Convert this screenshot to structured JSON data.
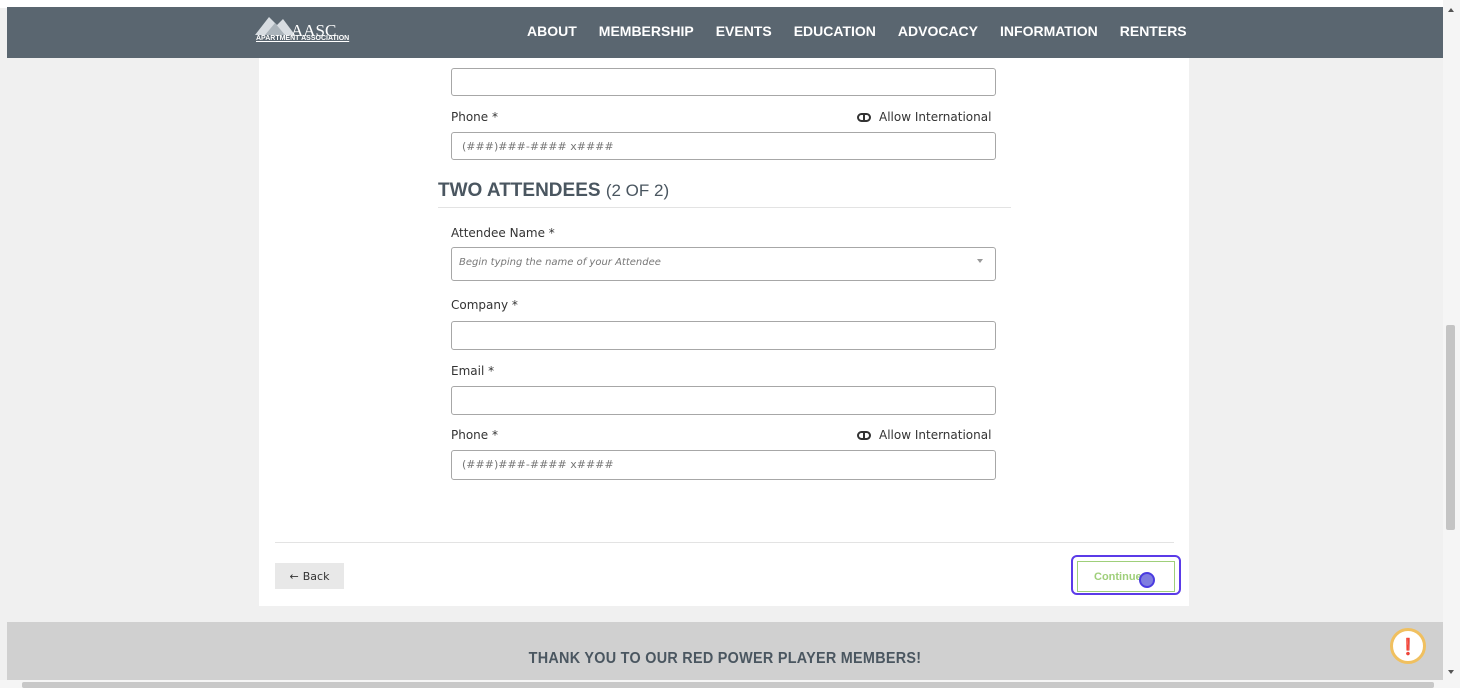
{
  "header": {
    "logo_text": "AASC",
    "logo_sub": "APARTMENT ASSOCIATION",
    "nav": [
      "ABOUT",
      "MEMBERSHIP",
      "EVENTS",
      "EDUCATION",
      "ADVOCACY",
      "INFORMATION",
      "RENTERS"
    ]
  },
  "form": {
    "attendee1": {
      "phone_label": "Phone *",
      "phone_placeholder": "(###)###-#### x####",
      "allow_international": "Allow International"
    },
    "section": {
      "title": "TWO ATTENDEES",
      "count": "(2 OF 2)"
    },
    "attendee2": {
      "name_label": "Attendee Name *",
      "name_placeholder": "Begin typing the name of your Attendee",
      "company_label": "Company *",
      "email_label": "Email *",
      "phone_label": "Phone *",
      "phone_placeholder": "(###)###-#### x####",
      "allow_international": "Allow International"
    }
  },
  "actions": {
    "back_label": "Back",
    "continue_label": "Continue"
  },
  "footer": {
    "text": "THANK YOU TO OUR RED POWER PLAYER MEMBERS!"
  }
}
